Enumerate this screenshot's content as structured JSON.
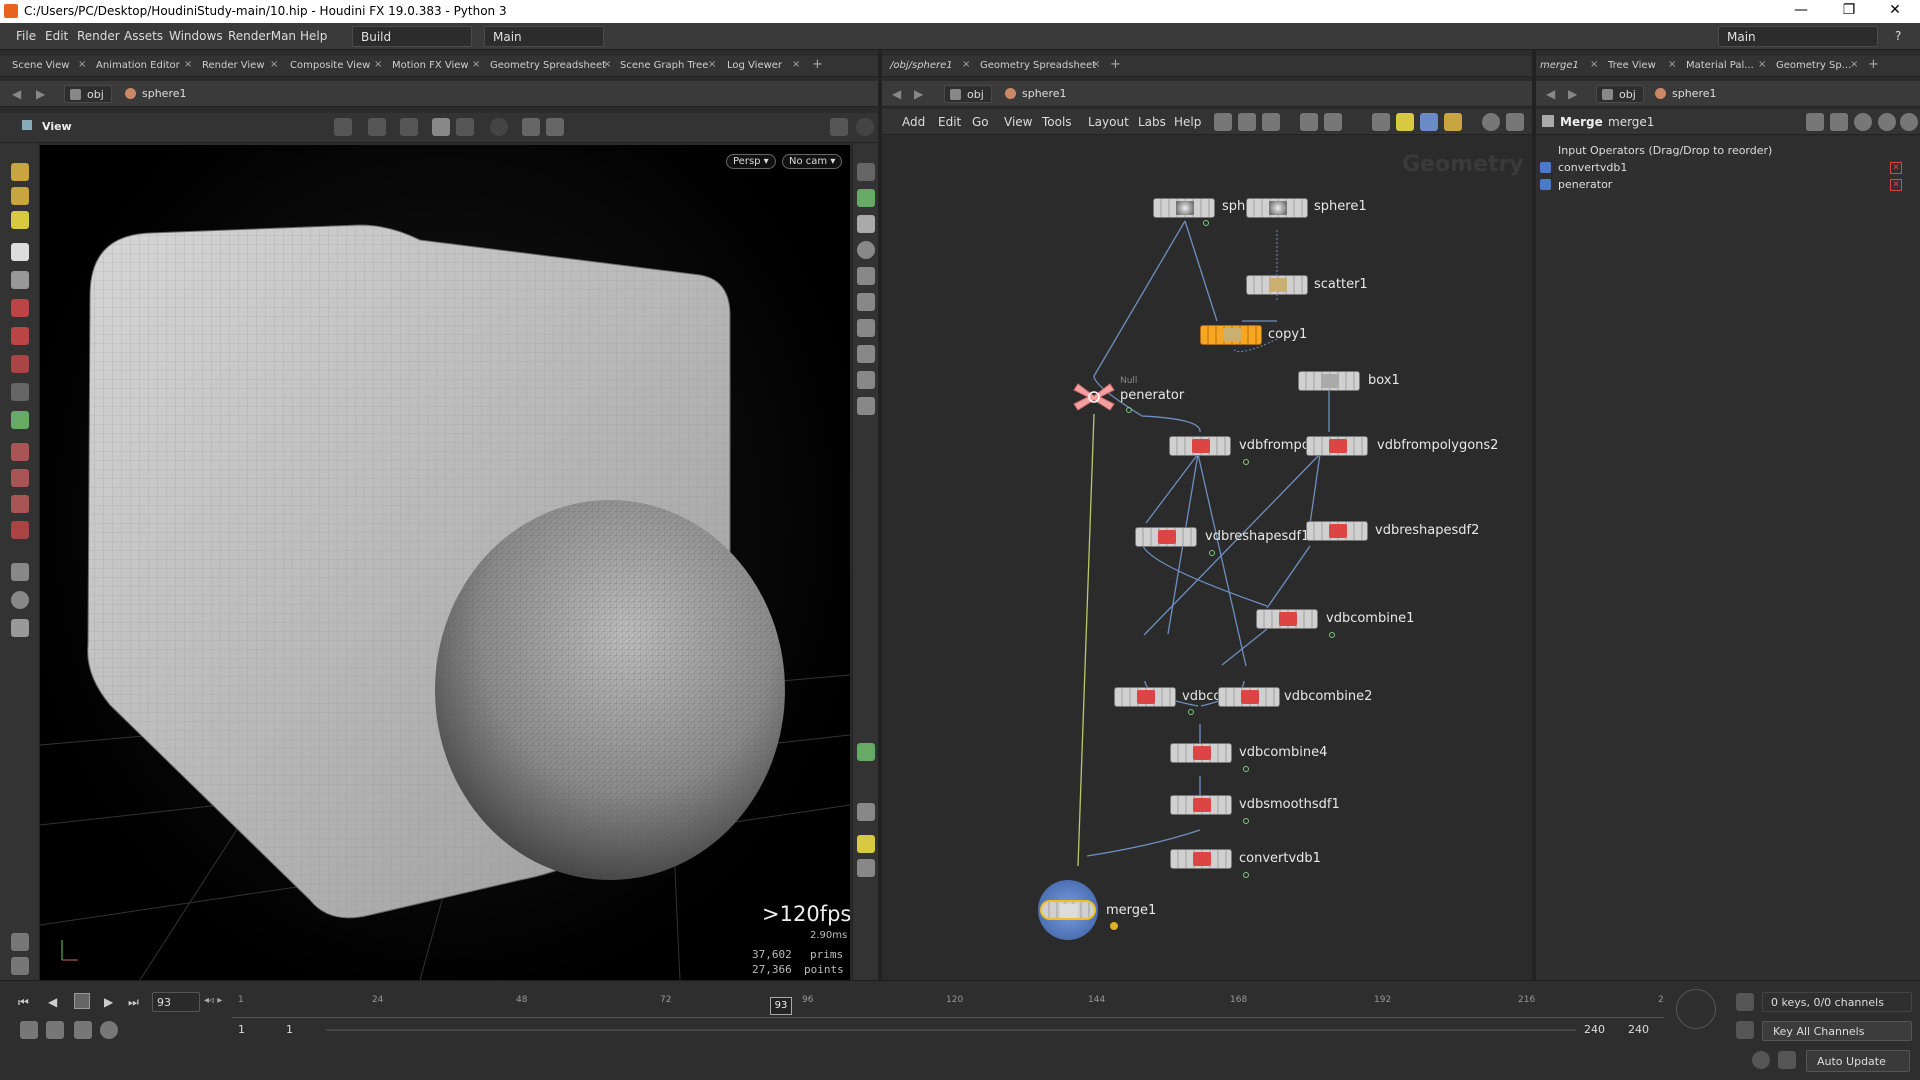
{
  "window": {
    "title": "C:/Users/PC/Desktop/HoudiniStudy-main/10.hip - Houdini FX 19.0.383 - Python 3"
  },
  "menu": [
    "File",
    "Edit",
    "Render",
    "Assets",
    "Windows",
    "RenderMan",
    "Help"
  ],
  "desktops": {
    "left": "Build",
    "middle": "Main",
    "right": "Main"
  },
  "left_tabs": [
    "Scene View",
    "Animation Editor",
    "Render View",
    "Composite View",
    "Motion FX View",
    "Geometry Spreadsheet",
    "Scene Graph Tree",
    "Log Viewer"
  ],
  "mid_tabs": [
    "/obj/sphere1",
    "Geometry Spreadsheet"
  ],
  "right_tabs": [
    "merge1",
    "Tree View",
    "Material Pal...",
    "Geometry Sp..."
  ],
  "path": {
    "obj": "obj",
    "node": "sphere1"
  },
  "viewer": {
    "label": "View",
    "persp": "Persp ▾",
    "cam": "No cam ▾",
    "fps": ">120fps",
    "ms": "2.90ms",
    "prims_count": "37,602",
    "prims_label": "prims",
    "points_count": "27,366",
    "points_label": "points"
  },
  "network_menu": [
    "Add",
    "Edit",
    "Go",
    "View",
    "Tools",
    "Layout",
    "Labs",
    "Help"
  ],
  "network_watermark": "Geometry",
  "nodes": {
    "sphere_a": "sph",
    "sphere1": "sphere1",
    "scatter1": "scatter1",
    "copy1": "copy1",
    "null_type": "Null",
    "generator": "penerator",
    "box1": "box1",
    "vdbfrompolygons1": "vdbfrompo",
    "vdbfrompolygons2": "vdbfrompolygons2",
    "vdbreshapesdf1": "vdbreshapesdf1",
    "vdbreshapesdf2": "vdbreshapesdf2",
    "vdbcombine1": "vdbcombine1",
    "vdbcombine3": "vdbco",
    "vdbcombine2": "vdbcombine2",
    "vdbcombine4": "vdbcombine4",
    "vdbsmoothsdf1": "vdbsmoothsdf1",
    "convertvdb1": "convertvdb1",
    "merge1": "merge1"
  },
  "params": {
    "type": "Merge",
    "name": "merge1",
    "list_title": "Input Operators (Drag/Drop to reorder)",
    "inputs": [
      "convertvdb1",
      "penerator"
    ]
  },
  "timeline": {
    "current_frame": "93",
    "marker": "93",
    "ticks": [
      "1",
      "24",
      "48",
      "72",
      "96",
      "120",
      "144",
      "168",
      "192",
      "216",
      "2"
    ],
    "start": "1",
    "start2": "1",
    "end": "240",
    "end2": "240",
    "keys": "0 keys, 0/0 channels",
    "key_all": "Key All Channels",
    "auto_update": "Auto Update"
  }
}
